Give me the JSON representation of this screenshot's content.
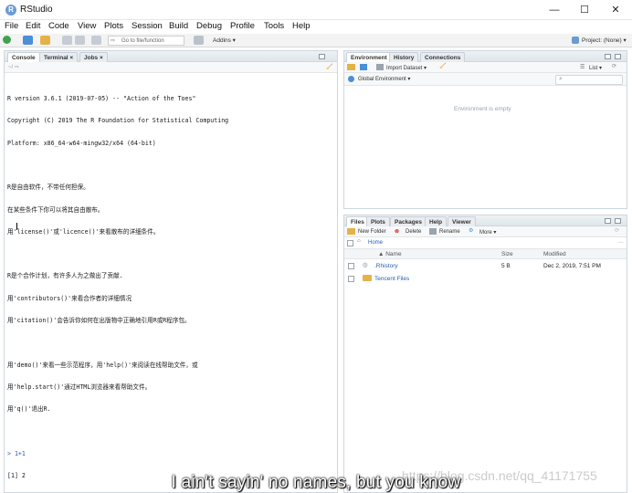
{
  "window": {
    "title": "RStudio",
    "app_icon_letter": "R",
    "minimize": "—",
    "maximize": "☐",
    "close": "✕"
  },
  "menu": [
    "File",
    "Edit",
    "Code",
    "View",
    "Plots",
    "Session",
    "Build",
    "Debug",
    "Profile",
    "Tools",
    "Help"
  ],
  "toolbar": {
    "goto_placeholder": "Go to file/function",
    "addins_label": "Addins ▾",
    "project_label": "Project: (None) ▾"
  },
  "console_pane": {
    "tabs": [
      "Console",
      "Terminal ×",
      "Jobs ×"
    ],
    "path": "~/ ⇨",
    "lines": [
      "R version 3.6.1 (2019-07-05) -- \"Action of the Toes\"",
      "Copyright (C) 2019 The R Foundation for Statistical Computing",
      "Platform: x86_64-w64-mingw32/x64 (64-bit)",
      "",
      "R是自由软件，不带任何担保。",
      "在某些条件下你可以将其自由散布。",
      "用'license()'或'licence()'来看散布的详细条件。",
      "",
      "R是个合作计划，有许多人为之做出了贡献.",
      "用'contributors()'来看合作者的详细情况",
      "用'citation()'会告诉你如何在出版物中正确地引用R或R程序包。",
      "",
      "用'demo()'来看一些示范程序，用'help()'来阅读在线帮助文件，或",
      "用'help.start()'通过HTML浏览器来看帮助文件。",
      "用'q()'退出R.",
      ""
    ],
    "input_line": "> 1+1",
    "output_line": "[1] 2",
    "current_prompt": ">"
  },
  "env_pane": {
    "tabs": [
      "Environment",
      "History",
      "Connections"
    ],
    "import_label": "Import Dataset ▾",
    "list_label": "List ▾",
    "scope_label": "Global Environment ▾",
    "empty_message": "Environment is empty"
  },
  "files_pane": {
    "tabs": [
      "Files",
      "Plots",
      "Packages",
      "Help",
      "Viewer"
    ],
    "new_folder": "New Folder",
    "delete": "Delete",
    "rename": "Rename",
    "more": "More ▾",
    "breadcrumb": "Home",
    "columns": {
      "name": "▲ Name",
      "size": "Size",
      "modified": "Modified"
    },
    "rows": [
      {
        "name": ".Rhistory",
        "size": "5 B",
        "modified": "Dec 2, 2019, 7:51 PM"
      },
      {
        "name": "Tencent Files",
        "size": "",
        "modified": ""
      }
    ]
  },
  "overlay": {
    "subtitle": "I ain't sayin' no names, but you know",
    "watermark": "https://blog.csdn.net/qq_41171755"
  },
  "colors": {
    "accent": "#2a5db0",
    "pane_border": "#cfd7df"
  }
}
